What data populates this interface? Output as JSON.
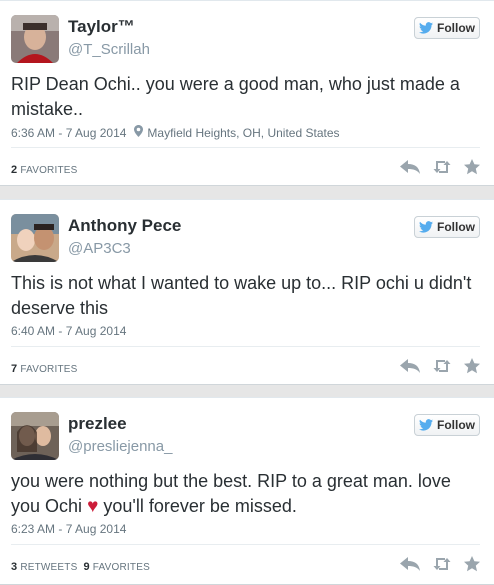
{
  "follow_label": "Follow",
  "colors": {
    "twitter_blue": "#55acee",
    "heart_red": "#cc1d39",
    "meta_gray": "#66757f"
  },
  "tweets": [
    {
      "name": "Taylor™",
      "handle": "@T_Scrillah",
      "text": "RIP Dean Ochi.. you were a good man, who just made a mistake..",
      "time": "6:36 AM - 7 Aug 2014",
      "location": "Mayfield Heights, OH, United States",
      "favorites_count": "2",
      "favorites_label": "FAVORITES",
      "icons": [
        "reply-icon",
        "retweet-icon",
        "favorite-icon"
      ]
    },
    {
      "name": "Anthony Pece",
      "handle": "@AP3C3",
      "text": "This is not what I wanted to wake up to... RIP ochi u didn't deserve this",
      "time": "6:40 AM - 7 Aug 2014",
      "favorites_count": "7",
      "favorites_label": "FAVORITES",
      "icons": [
        "reply-icon",
        "retweet-icon",
        "favorite-icon"
      ]
    },
    {
      "name": "prezlee",
      "handle": "@presliejenna_",
      "text_before": "you were nothing but the best. RIP to a great man. love you Ochi",
      "text_after": "you'll forever be missed.",
      "time": "6:23 AM - 7 Aug 2014",
      "retweets_count": "3",
      "retweets_label": "RETWEETS",
      "favorites_count": "9",
      "favorites_label": "FAVORITES",
      "icons": [
        "reply-icon",
        "retweet-icon",
        "favorite-icon"
      ]
    }
  ]
}
